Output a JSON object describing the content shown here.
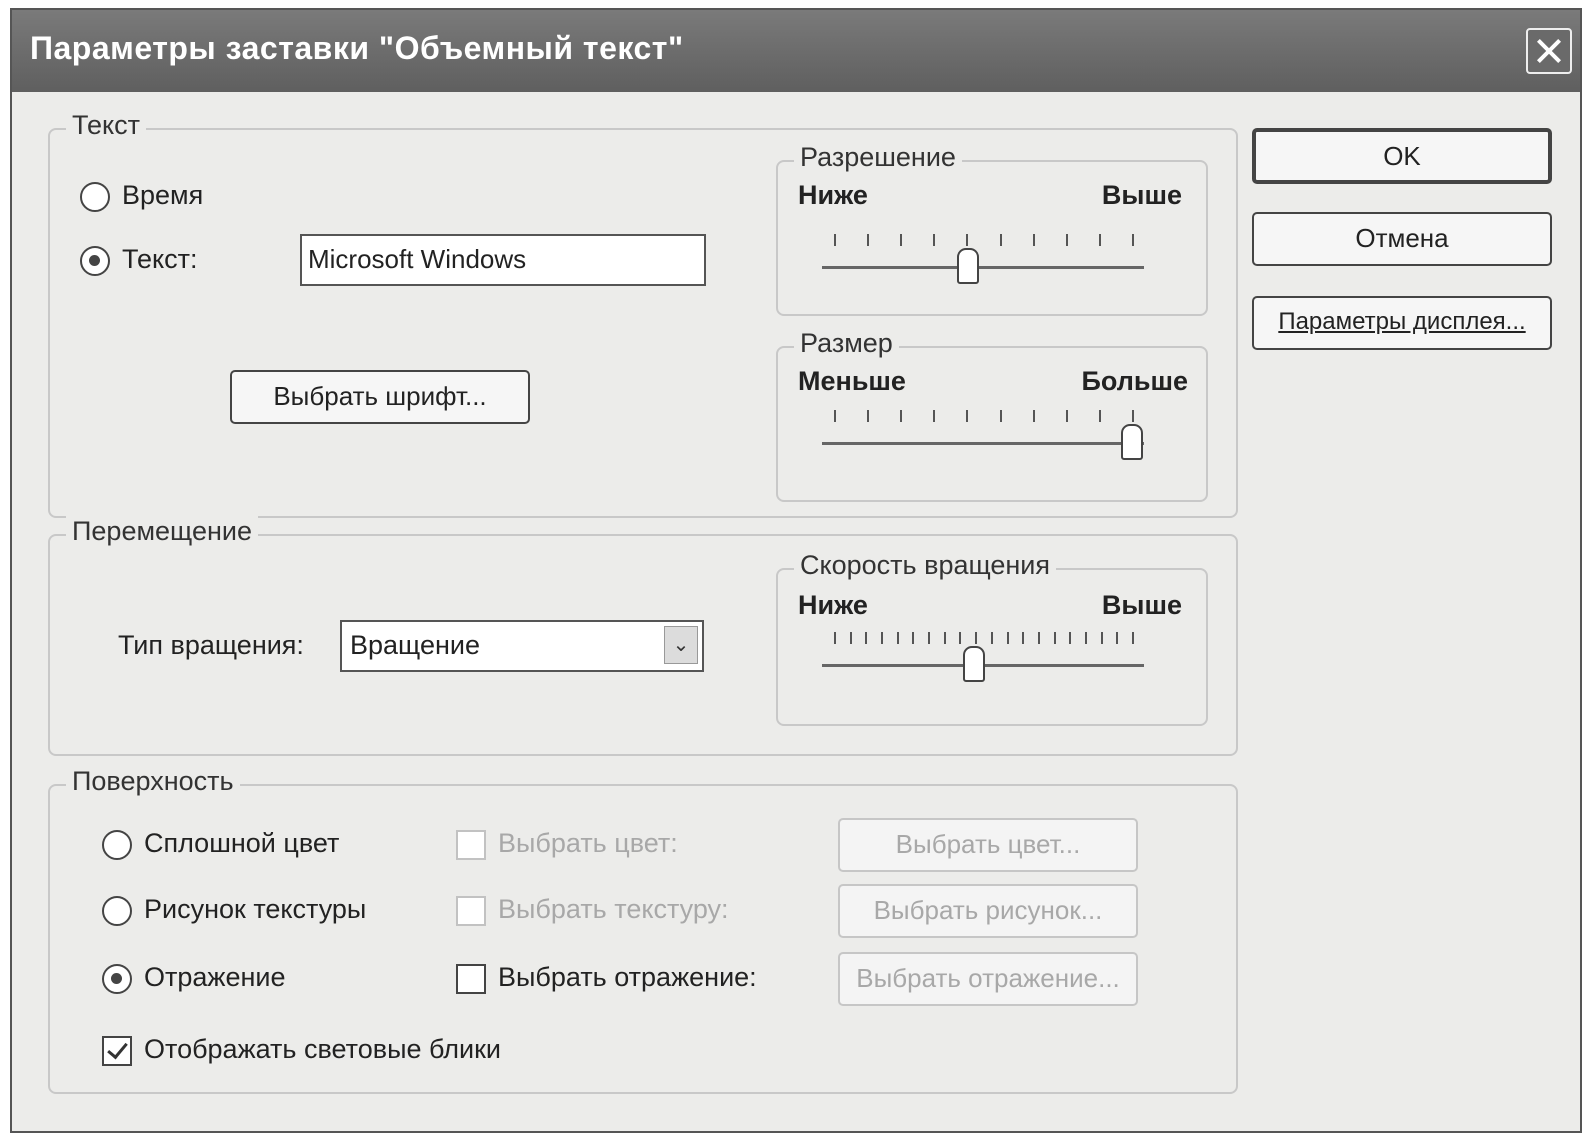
{
  "window": {
    "title": "Параметры заставки \"Объемный текст\""
  },
  "buttons": {
    "ok": "OK",
    "cancel": "Отмена",
    "display": "Параметры дисплея..."
  },
  "text_group": {
    "legend": "Текст",
    "radio_time": "Время",
    "radio_text": "Текст:",
    "text_value": "Microsoft Windows",
    "font_button": "Выбрать шрифт..."
  },
  "resolution": {
    "legend": "Разрешение",
    "low": "Ниже",
    "high": "Выше",
    "level": 0.45,
    "ticks": 10
  },
  "size": {
    "legend": "Размер",
    "low": "Меньше",
    "high": "Больше",
    "level": 1.0,
    "ticks": 10
  },
  "motion": {
    "legend": "Перемещение",
    "rotation_label": "Тип вращения:",
    "rotation_value": "Вращение"
  },
  "speed": {
    "legend": "Скорость вращения",
    "low": "Ниже",
    "high": "Выше",
    "level": 0.47,
    "ticks": 20
  },
  "surface": {
    "legend": "Поверхность",
    "solid": "Сплошной цвет",
    "texture": "Рисунок текстуры",
    "reflection": "Отражение",
    "choose_color_chk": "Выбрать цвет:",
    "choose_texture_chk": "Выбрать текстуру:",
    "choose_reflection_chk": "Выбрать отражение:",
    "color_btn": "Выбрать цвет...",
    "picture_btn": "Выбрать рисунок...",
    "reflection_btn": "Выбрать отражение...",
    "highlights": "Отображать световые блики"
  }
}
